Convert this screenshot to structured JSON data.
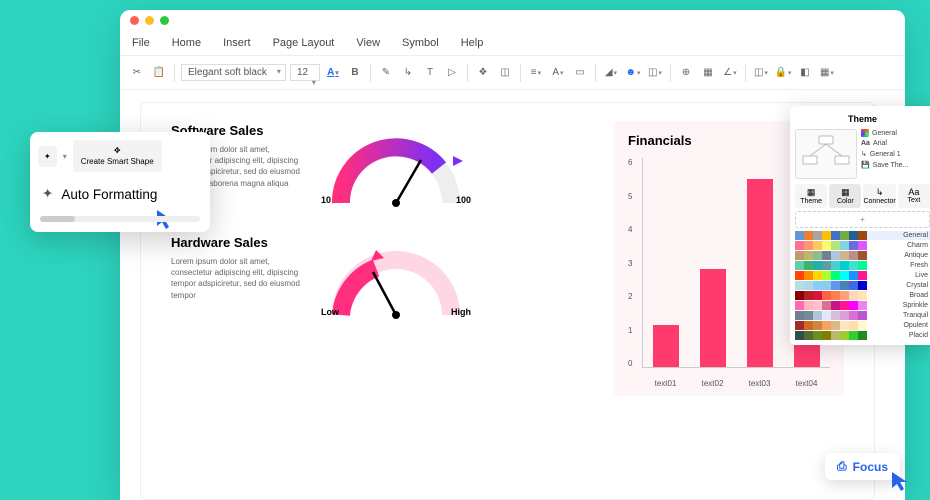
{
  "menubar": [
    "File",
    "Home",
    "Insert",
    "Page Layout",
    "View",
    "Symbol",
    "Help"
  ],
  "toolbar": {
    "font": "Elegant soft black",
    "size": "12"
  },
  "float": {
    "create_smart_shape": "Create Smart Shape",
    "auto_formatting": "Auto Formatting"
  },
  "software": {
    "title": "Software Sales",
    "body": "Lorem ipsum dolor sit amet, consectetur adipiscing elit, dipiscing tempor adspiciretur, sed do eiusmod tempor ut laborena magna aliqua",
    "left": "10",
    "right": "100"
  },
  "hardware": {
    "title": "Hardware Sales",
    "body": "Lorem ipsum dolor sit amet, consectetur adipiscing elit, dipiscing tempor adspiciretur, sed do eiusmod tempor",
    "left": "Low",
    "right": "High"
  },
  "financials": {
    "title": "Financials"
  },
  "chart_data": {
    "type": "bar",
    "categories": [
      "text01",
      "text02",
      "text03",
      "text04"
    ],
    "values": [
      1.2,
      2.8,
      5.4,
      4.7
    ],
    "ylim": [
      0,
      6
    ],
    "yticks": [
      0,
      1,
      2,
      3,
      4,
      5,
      6
    ],
    "title": "Financials",
    "color": "#ff3b6e"
  },
  "theme": {
    "title": "Theme",
    "tabs": [
      "Theme",
      "Color",
      "Connector",
      "Text"
    ],
    "active_tab": 1,
    "preview_side": [
      "General",
      "Arial",
      "General 1",
      "Save The..."
    ],
    "add": "+",
    "swatch_names": [
      "General",
      "Charm",
      "Antique",
      "Fresh",
      "Live",
      "Crystal",
      "Broad",
      "Sprinkle",
      "Tranquil",
      "Opulent",
      "Placid"
    ]
  },
  "focus": "Focus",
  "colors": {
    "accent": "#2563eb",
    "bar": "#ff3b6e"
  }
}
